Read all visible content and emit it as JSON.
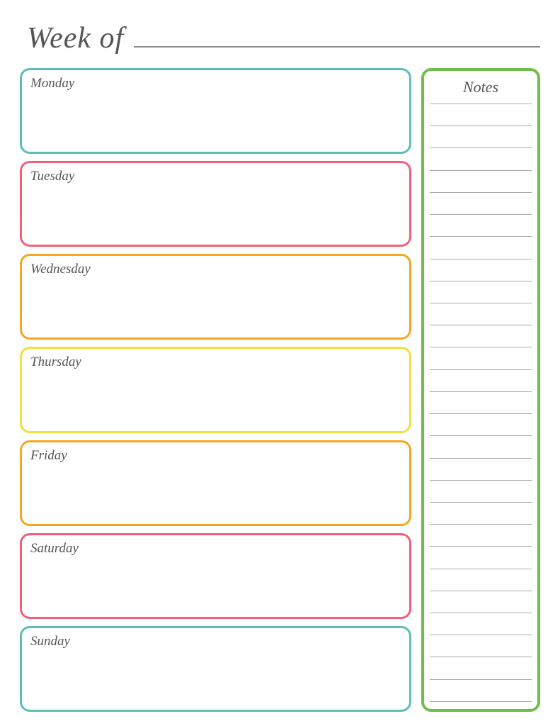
{
  "header": {
    "week_of_label": "Week of"
  },
  "days": [
    {
      "id": "monday",
      "label": "Monday",
      "color_class": "monday"
    },
    {
      "id": "tuesday",
      "label": "Tuesday",
      "color_class": "tuesday"
    },
    {
      "id": "wednesday",
      "label": "Wednesday",
      "color_class": "wednesday"
    },
    {
      "id": "thursday",
      "label": "Thursday",
      "color_class": "thursday"
    },
    {
      "id": "friday",
      "label": "Friday",
      "color_class": "friday"
    },
    {
      "id": "saturday",
      "label": "Saturday",
      "color_class": "saturday"
    },
    {
      "id": "sunday",
      "label": "Sunday",
      "color_class": "sunday"
    }
  ],
  "notes": {
    "title": "Notes",
    "line_count": 28
  }
}
